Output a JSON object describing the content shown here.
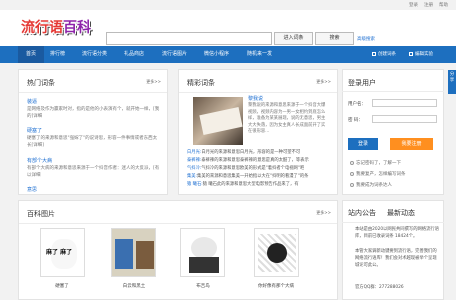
{
  "toplinks": [
    "登录",
    "注册",
    "帮助"
  ],
  "logo": {
    "part1": "流行语",
    "part2": "百科"
  },
  "search": {
    "placeholder": "",
    "btn_entry": "进入词条",
    "btn_search": "搜索",
    "advanced": "高级搜索"
  },
  "nav": {
    "items": [
      "首页",
      "排行榜",
      "流行语分类",
      "礼品商店",
      "流行语图片",
      "微信小程序",
      "随机来一发"
    ],
    "create": "创建词条",
    "edit": "编辑实验"
  },
  "hot": {
    "title": "热门词条",
    "more": "更多>>",
    "entries": [
      {
        "title": "装逼",
        "desc": "是网络及作为赢家时对，指的是他的小表演有个，就开始一样，[我的]详细"
      },
      {
        "title": "硬塞了",
        "desc": "硬塞了的来源和意思\"强嫁了\"的说诗思，形容一件事情或者东西太长[详细]"
      },
      {
        "title": "有部个大病",
        "desc": "有部个大病的来源和意思来源于一个抖音作者：迷人的大反派，[有以详细"
      },
      {
        "title": "意思",
        "desc": ""
      }
    ]
  },
  "featured": {
    "title": "精彩词条",
    "more": "更多>>",
    "main_title": "黎我说",
    "main_desc": "黎我说的来源和意思来源于一个抖音大爆视频，视频内容为一男一女相约到底怎么样，准备为某某展现，说的无意思，男主大大失落，因为女主真人长成面前开了实在很形容…",
    "list": [
      {
        "t": "白月光:",
        "d": "白月光的来源和意思白月光，形容的是一种可望不可"
      },
      {
        "t": "泰裤辣:",
        "d": "泰裤辣的来源和意思泰裤辣的意思是真的太酷了，等表示"
      },
      {
        "t": "气抖冷:",
        "d": "气抖冷的来源和意思欧美的形式是\"着抖者个电视网\"吧"
      },
      {
        "t": "集美:",
        "d": "集美的来源和意思集美一开始指以大在\"抖明的看漫了\"的条"
      },
      {
        "t": "猿 曦石:",
        "d": "猿 曦石此的来源和意思大型电影预告作品来了，有"
      }
    ]
  },
  "login": {
    "title": "登录用户",
    "user_label": "用户名：",
    "pass_label": "密 码：",
    "login_btn": "登录",
    "register_btn": "我要注册",
    "links": [
      "忘记密码了，了解一下",
      "我要复产，怎样编写词条",
      "我要成为词条达人"
    ]
  },
  "gallery": {
    "title": "百科图片",
    "more": "更多>>",
    "items": [
      {
        "caption": "硬塞了",
        "text": "麻了 麻了"
      },
      {
        "caption": "白云和黑土",
        "text": ""
      },
      {
        "caption": "布吉岛",
        "text": ""
      },
      {
        "caption": "你好像有那个大病",
        "text": ""
      }
    ]
  },
  "notice": {
    "title_a": "站内公告",
    "title_b": "最新动态",
    "text1": "本站是由2020以网民共同撰写的网络流行语库，目前已收录词条 18424个。",
    "text2": "本管大家调新动键要到流行语，完善我们的网络流行语库！我们会对术越现被举个呈现城论可此公。",
    "qq": "官方QQ群：277288026"
  },
  "side_tab": "分享"
}
